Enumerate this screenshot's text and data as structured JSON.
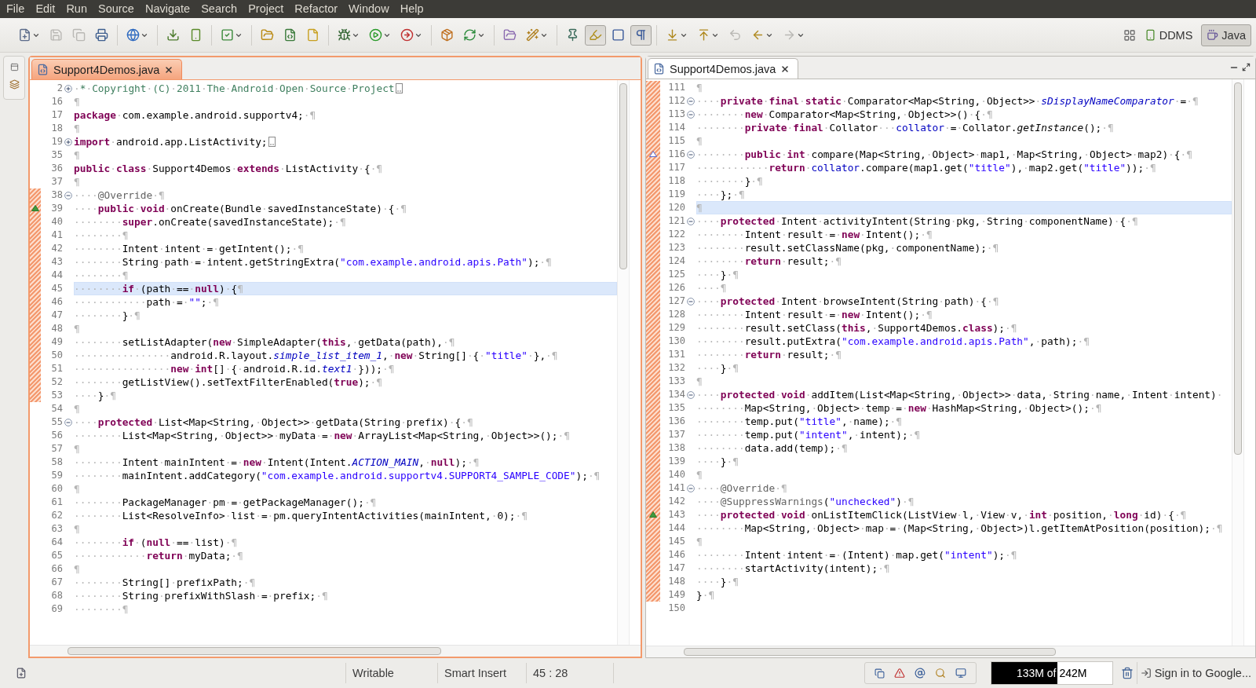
{
  "menu": [
    "File",
    "Edit",
    "Run",
    "Source",
    "Navigate",
    "Search",
    "Project",
    "Refactor",
    "Window",
    "Help"
  ],
  "toolbar": [
    [
      {
        "kind": "button",
        "disabled": false,
        "dropdown": true
      },
      {
        "kind": "button",
        "disabled": true,
        "dropdown": false
      },
      {
        "kind": "button",
        "disabled": true,
        "dropdown": false
      },
      {
        "kind": "button",
        "disabled": false,
        "dropdown": false
      }
    ],
    [
      {
        "kind": "button",
        "disabled": false,
        "dropdown": true
      }
    ],
    [
      {
        "kind": "button",
        "disabled": false,
        "dropdown": false
      },
      {
        "kind": "button",
        "disabled": false,
        "dropdown": false
      }
    ],
    [
      {
        "kind": "button",
        "disabled": false,
        "dropdown": true
      }
    ],
    [
      {
        "kind": "button",
        "disabled": false,
        "dropdown": false
      },
      {
        "kind": "button",
        "disabled": false,
        "dropdown": false
      },
      {
        "kind": "button",
        "disabled": false,
        "dropdown": false
      }
    ],
    [
      {
        "kind": "button",
        "disabled": false,
        "dropdown": true
      },
      {
        "kind": "button",
        "disabled": false,
        "dropdown": true
      },
      {
        "kind": "button",
        "disabled": false,
        "dropdown": true
      }
    ],
    [
      {
        "kind": "button",
        "disabled": false,
        "dropdown": false
      },
      {
        "kind": "button",
        "disabled": false,
        "dropdown": true
      }
    ],
    [
      {
        "kind": "button",
        "disabled": false,
        "dropdown": false
      },
      {
        "kind": "button",
        "disabled": false,
        "dropdown": true
      }
    ],
    [
      {
        "kind": "button",
        "disabled": false,
        "dropdown": false
      },
      {
        "kind": "toggle",
        "selected": true
      },
      {
        "kind": "toggle",
        "selected": false
      },
      {
        "kind": "toggle",
        "selected": true
      }
    ],
    [
      {
        "kind": "button",
        "disabled": false,
        "dropdown": true
      },
      {
        "kind": "button",
        "disabled": false,
        "dropdown": true
      },
      {
        "kind": "button",
        "disabled": true,
        "dropdown": false
      },
      {
        "kind": "button",
        "disabled": false,
        "dropdown": true
      },
      {
        "kind": "button",
        "disabled": true,
        "dropdown": true
      }
    ]
  ],
  "perspectives": [
    {
      "label": "DDMS",
      "selected": false
    },
    {
      "label": "Java",
      "selected": true
    }
  ],
  "editors": [
    {
      "active": true,
      "tab": {
        "label": "Support4Demos.java"
      },
      "lines": [
        {
          "n": "2",
          "fold": {
            "expanded": false
          },
          "change": false,
          "current": false,
          "tokens": [
            {
              "kind": "comment",
              "text": "·*·Copyright·(C)·2011·The·Android·Open·Source·Project"
            }
          ]
        },
        {
          "n": "16",
          "change": false,
          "current": false,
          "tokens": [
            "¶"
          ]
        },
        {
          "n": "17",
          "change": false,
          "current": false,
          "tokens": [
            {
              "kind": "kw",
              "text": "package"
            },
            "·com.example.android.supportv4;·¶"
          ]
        },
        {
          "n": "18",
          "change": false,
          "current": false,
          "tokens": [
            "¶"
          ]
        },
        {
          "n": "19",
          "fold": {
            "expanded": false
          },
          "change": false,
          "current": false,
          "tokens": [
            {
              "kind": "kw",
              "text": "import"
            },
            "·android.app.ListActivity;"
          ]
        },
        {
          "n": "35",
          "change": false,
          "current": false,
          "tokens": [
            "¶"
          ]
        },
        {
          "n": "36",
          "change": false,
          "current": false,
          "tokens": [
            {
              "kind": "kw",
              "text": "public"
            },
            "·",
            {
              "kind": "kw",
              "text": "class"
            },
            "·Support4Demos·",
            {
              "kind": "kw",
              "text": "extends"
            },
            "·ListActivity·{·¶"
          ]
        },
        {
          "n": "37",
          "change": false,
          "current": false,
          "tokens": [
            "¶"
          ]
        },
        {
          "n": "38",
          "fold": {
            "expanded": true
          },
          "change": true,
          "current": false,
          "tokens": [
            "····",
            {
              "kind": "ann",
              "text": "@Override"
            },
            "·¶"
          ]
        },
        {
          "n": "39",
          "marker": {
            "kind": "override"
          },
          "change": true,
          "current": false,
          "tokens": [
            "····",
            {
              "kind": "kw",
              "text": "public"
            },
            "·",
            {
              "kind": "kw",
              "text": "void"
            },
            "·onCreate(Bundle·savedInstanceState)·{·¶"
          ]
        },
        {
          "n": "40",
          "change": true,
          "current": false,
          "tokens": [
            "········",
            {
              "kind": "kw",
              "text": "super"
            },
            ".onCreate(savedInstanceState);·¶"
          ]
        },
        {
          "n": "41",
          "change": true,
          "current": false,
          "tokens": [
            "········¶"
          ]
        },
        {
          "n": "42",
          "change": true,
          "current": false,
          "tokens": [
            "········Intent·intent·=·getIntent();·¶"
          ]
        },
        {
          "n": "43",
          "change": true,
          "current": false,
          "tokens": [
            "········String·path·=·intent.getStringExtra(",
            {
              "kind": "str",
              "text": "\"com.example.android.apis.Path\""
            },
            ");·¶"
          ]
        },
        {
          "n": "44",
          "change": true,
          "current": false,
          "tokens": [
            "········¶"
          ]
        },
        {
          "n": "45",
          "change": true,
          "current": true,
          "tokens": [
            "········",
            {
              "kind": "kw",
              "text": "if"
            },
            "·(path·==·",
            {
              "kind": "kw",
              "text": "null"
            },
            ")·{¶"
          ]
        },
        {
          "n": "46",
          "change": true,
          "current": false,
          "tokens": [
            "············path·=·",
            {
              "kind": "str",
              "text": "\"\""
            },
            ";·¶"
          ]
        },
        {
          "n": "47",
          "change": true,
          "current": false,
          "tokens": [
            "········}·¶"
          ]
        },
        {
          "n": "48",
          "change": true,
          "current": false,
          "tokens": [
            "¶"
          ]
        },
        {
          "n": "49",
          "change": true,
          "current": false,
          "tokens": [
            "········setListAdapter(",
            {
              "kind": "kw",
              "text": "new"
            },
            "·SimpleAdapter(",
            {
              "kind": "kw",
              "text": "this"
            },
            ",·getData(path),·¶"
          ]
        },
        {
          "n": "50",
          "change": true,
          "current": false,
          "tokens": [
            "················android.R.layout.",
            {
              "kind": "static",
              "text": "simple_list_item_1"
            },
            ",·",
            {
              "kind": "kw",
              "text": "new"
            },
            "·String[]·{·",
            {
              "kind": "str",
              "text": "\"title\""
            },
            "·},·¶"
          ]
        },
        {
          "n": "51",
          "change": true,
          "current": false,
          "tokens": [
            "················",
            {
              "kind": "kw",
              "text": "new"
            },
            "·",
            {
              "kind": "kw",
              "text": "int"
            },
            "[]·{·android.R.id.",
            {
              "kind": "static",
              "text": "text1"
            },
            "·}));·¶"
          ]
        },
        {
          "n": "52",
          "change": true,
          "current": false,
          "tokens": [
            "········getListView().setTextFilterEnabled(",
            {
              "kind": "kw",
              "text": "true"
            },
            ");·¶"
          ]
        },
        {
          "n": "53",
          "change": true,
          "current": false,
          "tokens": [
            "····}·¶"
          ]
        },
        {
          "n": "54",
          "change": false,
          "current": false,
          "tokens": [
            "¶"
          ]
        },
        {
          "n": "55",
          "fold": {
            "expanded": true
          },
          "change": false,
          "current": false,
          "tokens": [
            "····",
            {
              "kind": "kw",
              "text": "protected"
            },
            "·List<Map<String,·Object>>·getData(String·prefix)·{·¶"
          ]
        },
        {
          "n": "56",
          "change": false,
          "current": false,
          "tokens": [
            "········List<Map<String,·Object>>·myData·=·",
            {
              "kind": "kw",
              "text": "new"
            },
            "·ArrayList<Map<String,·Object>>();·¶"
          ]
        },
        {
          "n": "57",
          "change": false,
          "current": false,
          "tokens": [
            "¶"
          ]
        },
        {
          "n": "58",
          "change": false,
          "current": false,
          "tokens": [
            "········Intent·mainIntent·=·",
            {
              "kind": "kw",
              "text": "new"
            },
            "·Intent(Intent.",
            {
              "kind": "static",
              "text": "ACTION_MAIN"
            },
            ",·",
            {
              "kind": "kw",
              "text": "null"
            },
            ");·¶"
          ]
        },
        {
          "n": "59",
          "change": false,
          "current": false,
          "tokens": [
            "········mainIntent.addCategory(",
            {
              "kind": "str",
              "text": "\"com.example.android.supportv4.SUPPORT4_SAMPLE_CODE\""
            },
            ");·¶"
          ]
        },
        {
          "n": "60",
          "change": false,
          "current": false,
          "tokens": [
            "¶"
          ]
        },
        {
          "n": "61",
          "change": false,
          "current": false,
          "tokens": [
            "········PackageManager·pm·=·getPackageManager();·¶"
          ]
        },
        {
          "n": "62",
          "change": false,
          "current": false,
          "tokens": [
            "········List<ResolveInfo>·list·=·pm.queryIntentActivities(mainIntent,·0);·¶"
          ]
        },
        {
          "n": "63",
          "change": false,
          "current": false,
          "tokens": [
            "¶"
          ]
        },
        {
          "n": "64",
          "change": false,
          "current": false,
          "tokens": [
            "········",
            {
              "kind": "kw",
              "text": "if"
            },
            "·(",
            {
              "kind": "kw",
              "text": "null"
            },
            "·==·list)·¶"
          ]
        },
        {
          "n": "65",
          "change": false,
          "current": false,
          "tokens": [
            "············",
            {
              "kind": "kw",
              "text": "return"
            },
            "·myData;·¶"
          ]
        },
        {
          "n": "66",
          "change": false,
          "current": false,
          "tokens": [
            "¶"
          ]
        },
        {
          "n": "67",
          "change": false,
          "current": false,
          "tokens": [
            "········String[]·prefixPath;·¶"
          ]
        },
        {
          "n": "68",
          "change": false,
          "current": false,
          "tokens": [
            "········String·prefixWithSlash·=·prefix;·¶"
          ]
        },
        {
          "n": "69",
          "change": false,
          "current": false,
          "tokens": [
            "········¶"
          ]
        }
      ]
    },
    {
      "active": false,
      "tab": {
        "label": "Support4Demos.java"
      },
      "lines": [
        {
          "n": "111",
          "change": true,
          "current": false,
          "tokens": [
            "¶"
          ]
        },
        {
          "n": "112",
          "fold": {
            "expanded": true
          },
          "change": true,
          "current": false,
          "tokens": [
            "····",
            {
              "kind": "kw",
              "text": "private"
            },
            "·",
            {
              "kind": "kw",
              "text": "final"
            },
            "·",
            {
              "kind": "kw",
              "text": "static"
            },
            "·Comparator<Map<String,·Object>>·",
            {
              "kind": "static",
              "text": "sDisplayNameComparator"
            },
            "·=·¶"
          ]
        },
        {
          "n": "113",
          "fold": {
            "expanded": true
          },
          "change": true,
          "current": false,
          "tokens": [
            "········",
            {
              "kind": "kw",
              "text": "new"
            },
            "·Comparator<Map<String,·Object>>()·{·¶"
          ]
        },
        {
          "n": "114",
          "change": true,
          "current": false,
          "tokens": [
            "········",
            {
              "kind": "kw",
              "text": "private"
            },
            "·",
            {
              "kind": "kw",
              "text": "final"
            },
            "·Collator···",
            {
              "kind": "field",
              "text": "collator"
            },
            "·=·Collator.",
            {
              "kind": "smethod",
              "text": "getInstance"
            },
            "();·¶"
          ]
        },
        {
          "n": "115",
          "change": true,
          "current": false,
          "tokens": [
            "¶"
          ]
        },
        {
          "n": "116",
          "fold": {
            "expanded": true
          },
          "marker": {
            "kind": "implement"
          },
          "change": true,
          "current": false,
          "tokens": [
            "········",
            {
              "kind": "kw",
              "text": "public"
            },
            "·",
            {
              "kind": "kw",
              "text": "int"
            },
            "·compare(Map<String,·Object>·map1,·Map<String,·Object>·map2)·{·¶"
          ]
        },
        {
          "n": "117",
          "change": true,
          "current": false,
          "tokens": [
            "············",
            {
              "kind": "kw",
              "text": "return"
            },
            "·",
            {
              "kind": "field",
              "text": "collator"
            },
            ".compare(map1.get(",
            {
              "kind": "str",
              "text": "\"title\""
            },
            "),·map2.get(",
            {
              "kind": "str",
              "text": "\"title\""
            },
            "));·¶"
          ]
        },
        {
          "n": "118",
          "change": true,
          "current": false,
          "tokens": [
            "········}·¶"
          ]
        },
        {
          "n": "119",
          "change": true,
          "current": false,
          "tokens": [
            "····};·¶"
          ]
        },
        {
          "n": "120",
          "change": true,
          "current": true,
          "tokens": [
            "¶"
          ]
        },
        {
          "n": "121",
          "fold": {
            "expanded": true
          },
          "change": true,
          "current": false,
          "tokens": [
            "····",
            {
              "kind": "kw",
              "text": "protected"
            },
            "·Intent·activityIntent(String·pkg,·String·componentName)·{·¶"
          ]
        },
        {
          "n": "122",
          "change": true,
          "current": false,
          "tokens": [
            "········Intent·result·=·",
            {
              "kind": "kw",
              "text": "new"
            },
            "·Intent();·¶"
          ]
        },
        {
          "n": "123",
          "change": true,
          "current": false,
          "tokens": [
            "········result.setClassName(pkg,·componentName);·¶"
          ]
        },
        {
          "n": "124",
          "change": true,
          "current": false,
          "tokens": [
            "········",
            {
              "kind": "kw",
              "text": "return"
            },
            "·result;·¶"
          ]
        },
        {
          "n": "125",
          "change": true,
          "current": false,
          "tokens": [
            "····}·¶"
          ]
        },
        {
          "n": "126",
          "change": true,
          "current": false,
          "tokens": [
            "····¶"
          ]
        },
        {
          "n": "127",
          "fold": {
            "expanded": true
          },
          "change": true,
          "current": false,
          "tokens": [
            "····",
            {
              "kind": "kw",
              "text": "protected"
            },
            "·Intent·browseIntent(String·path)·{·¶"
          ]
        },
        {
          "n": "128",
          "change": true,
          "current": false,
          "tokens": [
            "········Intent·result·=·",
            {
              "kind": "kw",
              "text": "new"
            },
            "·Intent();·¶"
          ]
        },
        {
          "n": "129",
          "change": true,
          "current": false,
          "tokens": [
            "········result.setClass(",
            {
              "kind": "kw",
              "text": "this"
            },
            ",·Support4Demos.",
            {
              "kind": "kw",
              "text": "class"
            },
            ");·¶"
          ]
        },
        {
          "n": "130",
          "change": true,
          "current": false,
          "tokens": [
            "········result.putExtra(",
            {
              "kind": "str",
              "text": "\"com.example.android.apis.Path\""
            },
            ",·path);·¶"
          ]
        },
        {
          "n": "131",
          "change": true,
          "current": false,
          "tokens": [
            "········",
            {
              "kind": "kw",
              "text": "return"
            },
            "·result;·¶"
          ]
        },
        {
          "n": "132",
          "change": true,
          "current": false,
          "tokens": [
            "····}·¶"
          ]
        },
        {
          "n": "133",
          "change": true,
          "current": false,
          "tokens": [
            "¶"
          ]
        },
        {
          "n": "134",
          "fold": {
            "expanded": true
          },
          "change": true,
          "current": false,
          "tokens": [
            "····",
            {
              "kind": "kw",
              "text": "protected"
            },
            "·",
            {
              "kind": "kw",
              "text": "void"
            },
            "·addItem(List<Map<String,·Object>>·data,·String·name,·Intent·intent)·"
          ]
        },
        {
          "n": "135",
          "change": true,
          "current": false,
          "tokens": [
            "········Map<String,·Object>·temp·=·",
            {
              "kind": "kw",
              "text": "new"
            },
            "·HashMap<String,·Object>();·¶"
          ]
        },
        {
          "n": "136",
          "change": true,
          "current": false,
          "tokens": [
            "········temp.put(",
            {
              "kind": "str",
              "text": "\"title\""
            },
            ",·name);·¶"
          ]
        },
        {
          "n": "137",
          "change": true,
          "current": false,
          "tokens": [
            "········temp.put(",
            {
              "kind": "str",
              "text": "\"intent\""
            },
            ",·intent);·¶"
          ]
        },
        {
          "n": "138",
          "change": true,
          "current": false,
          "tokens": [
            "········data.add(temp);·¶"
          ]
        },
        {
          "n": "139",
          "change": true,
          "current": false,
          "tokens": [
            "····}·¶"
          ]
        },
        {
          "n": "140",
          "change": true,
          "current": false,
          "tokens": [
            "¶"
          ]
        },
        {
          "n": "141",
          "fold": {
            "expanded": true
          },
          "change": true,
          "current": false,
          "tokens": [
            "····",
            {
              "kind": "ann",
              "text": "@Override"
            },
            "·¶"
          ]
        },
        {
          "n": "142",
          "change": true,
          "current": false,
          "tokens": [
            "····",
            {
              "kind": "ann",
              "text": "@SuppressWarnings"
            },
            "(",
            {
              "kind": "str",
              "text": "\"unchecked\""
            },
            ")·¶"
          ]
        },
        {
          "n": "143",
          "marker": {
            "kind": "override"
          },
          "change": true,
          "current": false,
          "tokens": [
            "····",
            {
              "kind": "kw",
              "text": "protected"
            },
            "·",
            {
              "kind": "kw",
              "text": "void"
            },
            "·onListItemClick(ListView·l,·View·v,·",
            {
              "kind": "kw",
              "text": "int"
            },
            "·position,·",
            {
              "kind": "kw",
              "text": "long"
            },
            "·id)·{·¶"
          ]
        },
        {
          "n": "144",
          "change": true,
          "current": false,
          "tokens": [
            "········Map<String,·Object>·map·=·(Map<String,·Object>)l.getItemAtPosition(position);·¶"
          ]
        },
        {
          "n": "145",
          "change": true,
          "current": false,
          "tokens": [
            "¶"
          ]
        },
        {
          "n": "146",
          "change": true,
          "current": false,
          "tokens": [
            "········Intent·intent·=·(Intent)·map.get(",
            {
              "kind": "str",
              "text": "\"intent\""
            },
            ");·¶"
          ]
        },
        {
          "n": "147",
          "change": true,
          "current": false,
          "tokens": [
            "········startActivity(intent);·¶"
          ]
        },
        {
          "n": "148",
          "change": true,
          "current": false,
          "tokens": [
            "····}·¶"
          ]
        },
        {
          "n": "149",
          "change": true,
          "current": false,
          "tokens": [
            "}·¶"
          ]
        },
        {
          "n": "150",
          "change": false,
          "current": false
        }
      ]
    }
  ],
  "status_bar": {
    "mode": "Writable",
    "insert": "Smart Insert",
    "position": "45 : 28",
    "heap": {
      "label": "133M of 242M",
      "level": 0.55
    },
    "sign_in": "Sign in to Google..."
  }
}
